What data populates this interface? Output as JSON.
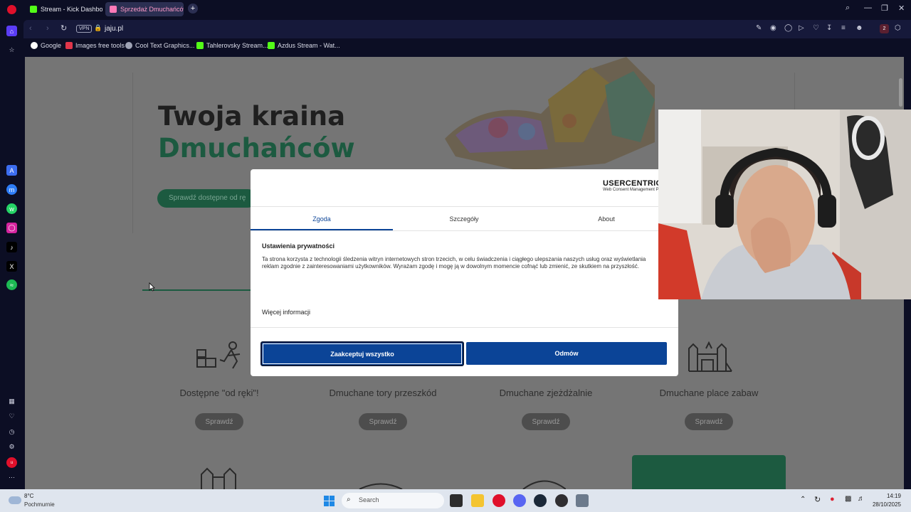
{
  "tabs": [
    {
      "label": "Stream - Kick Dashboard"
    },
    {
      "label": "Sprzedaż Dmuchańców - "
    }
  ],
  "address": {
    "vpn_label": "VPN",
    "url": "jaju.pl"
  },
  "bookmarks": [
    {
      "label": "Google"
    },
    {
      "label": "Images free tools"
    },
    {
      "label": "Cool Text Graphics..."
    },
    {
      "label": "Tahlerovsky Stream..."
    },
    {
      "label": "Azdus Stream - Wat..."
    }
  ],
  "hero": {
    "line1": "Twoja kraina",
    "line2": "Dmuchańców",
    "cta": "Sprawdź dostępne od rę"
  },
  "categories": [
    {
      "label": "Dostępne \"od ręki\"!",
      "button": "Sprawdź"
    },
    {
      "label": "Dmuchane tory przeszkód",
      "button": "Sprawdź"
    },
    {
      "label": "Dmuchane zjeżdżalnie",
      "button": "Sprawdź"
    },
    {
      "label": "Dmuchane place zabaw",
      "button": "Sprawdź"
    }
  ],
  "consent": {
    "brand": "USERCENTRIC",
    "brand_sub": "Web Consent Management Platf",
    "tabs": [
      "Zgoda",
      "Szczegóły",
      "About"
    ],
    "heading": "Ustawienia prywatności",
    "body": "Ta strona korzysta z technologii śledzenia witryn internetowych stron trzecich, w celu świadczenia i ciągłego ulepszania naszych usług oraz wyświetlania reklam zgodnie z zainteresowaniami użytkowników. Wyrażam zgodę i mogę ją w dowolnym momencie cofnąć lub zmienić, ze skutkiem na przyszłość.",
    "more_info": "Więcej informacji",
    "accept": "Zaakceptuj wszystko",
    "deny": "Odmów"
  },
  "taskbar": {
    "temperature": "8°C",
    "weather": "Pochmurnie",
    "search_placeholder": "Search",
    "time": "14:19",
    "date": "28/10/2025"
  },
  "colors": {
    "brand_green": "#1d7a55",
    "consent_blue": "#0b4497",
    "browser_bg": "#0c0e24"
  }
}
